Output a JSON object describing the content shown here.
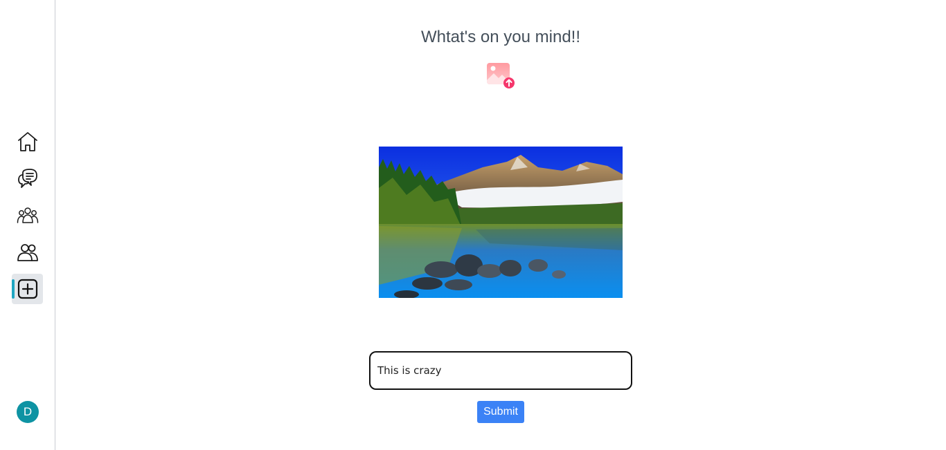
{
  "sidebar": {
    "items": [
      {
        "name": "home",
        "icon": "home-icon",
        "active": false
      },
      {
        "name": "chat",
        "icon": "chat-bubbles-icon",
        "active": false
      },
      {
        "name": "groups",
        "icon": "group-icon",
        "active": false
      },
      {
        "name": "friends",
        "icon": "people-icon",
        "active": false
      },
      {
        "name": "create-post",
        "icon": "plus-square-icon",
        "active": true
      }
    ],
    "accent_color": "#1fa6c2",
    "avatar": {
      "initial": "D",
      "color": "#0e93a3"
    }
  },
  "main": {
    "title": "Whtat's on you mind!!",
    "upload_icon": "image-upload-icon",
    "preview_image": "mountain-lake-landscape",
    "post_input": {
      "value": "This is crazy",
      "placeholder": ""
    },
    "submit_label": "Submit",
    "submit_color": "#3b82f6"
  }
}
